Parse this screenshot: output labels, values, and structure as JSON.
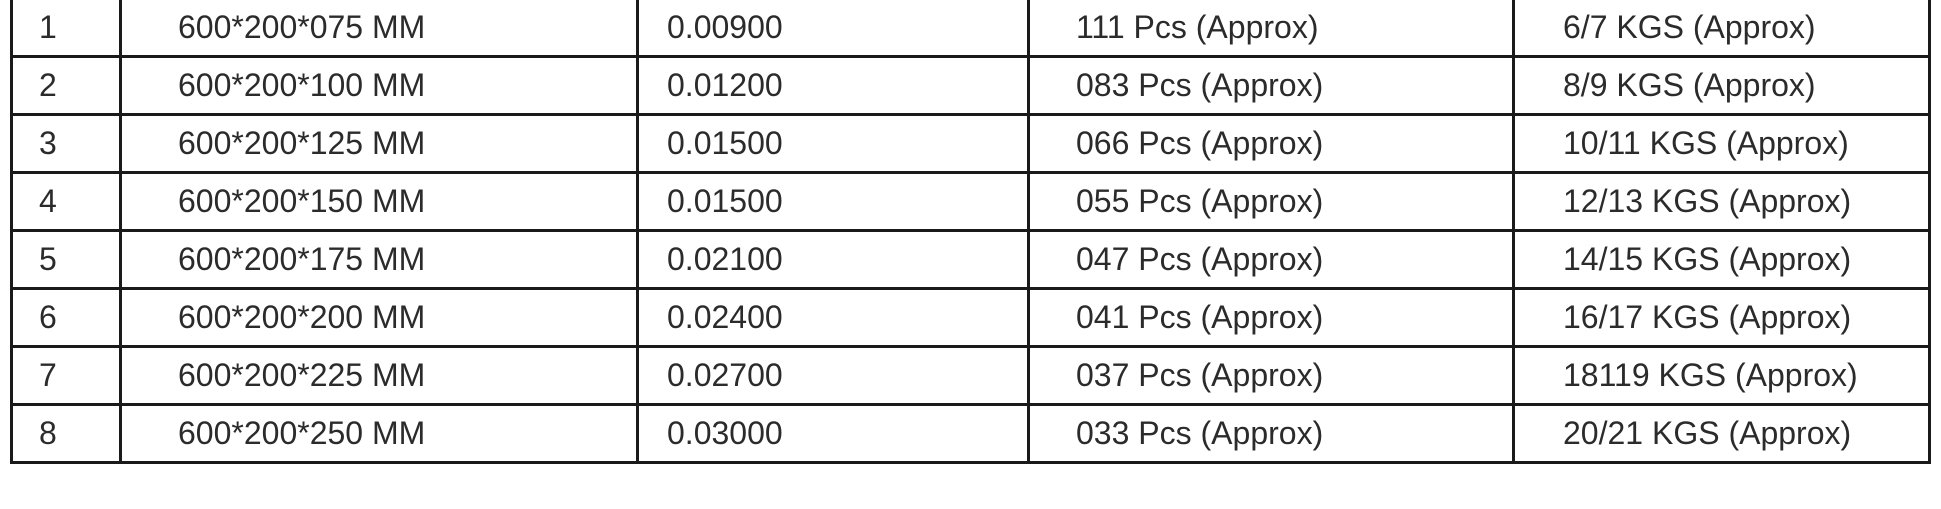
{
  "table": {
    "rows": [
      {
        "no": "1",
        "size": "600*200*075 MM",
        "volume": "0.00900",
        "pieces": "111 Pcs (Approx)",
        "weight": "6/7 KGS (Approx)"
      },
      {
        "no": "2",
        "size": "600*200*100 MM",
        "volume": "0.01200",
        "pieces": "083 Pcs (Approx)",
        "weight": "8/9 KGS (Approx)"
      },
      {
        "no": "3",
        "size": "600*200*125 MM",
        "volume": "0.01500",
        "pieces": "066 Pcs (Approx)",
        "weight": "10/11 KGS (Approx)"
      },
      {
        "no": "4",
        "size": "600*200*150 MM",
        "volume": "0.01500",
        "pieces": "055 Pcs (Approx)",
        "weight": "12/13 KGS (Approx)"
      },
      {
        "no": "5",
        "size": "600*200*175 MM",
        "volume": "0.02100",
        "pieces": "047 Pcs (Approx)",
        "weight": "14/15 KGS (Approx)"
      },
      {
        "no": "6",
        "size": "600*200*200 MM",
        "volume": "0.02400",
        "pieces": "041 Pcs (Approx)",
        "weight": "16/17 KGS (Approx)"
      },
      {
        "no": "7",
        "size": "600*200*225 MM",
        "volume": "0.02700",
        "pieces": "037 Pcs (Approx)",
        "weight": "18119 KGS (Approx)"
      },
      {
        "no": "8",
        "size": "600*200*250 MM",
        "volume": "0.03000",
        "pieces": "033 Pcs (Approx)",
        "weight": "20/21 KGS (Approx)"
      }
    ]
  }
}
